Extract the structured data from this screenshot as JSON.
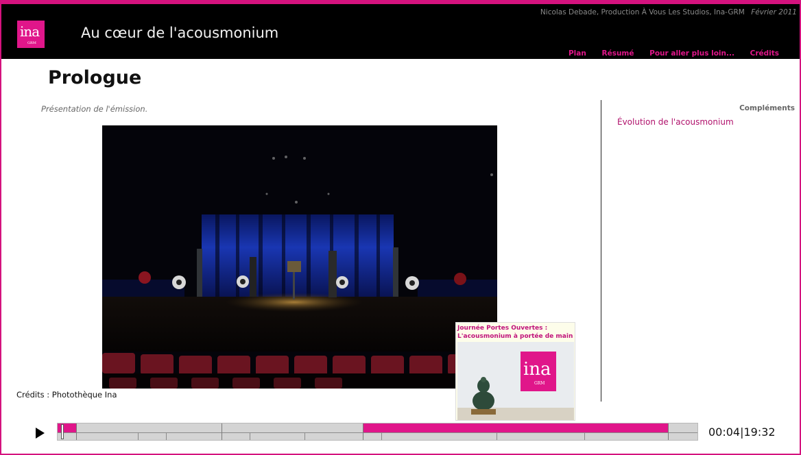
{
  "header": {
    "logo_text": "ina",
    "logo_sub": "GRM",
    "title": "Au cœur de l'acousmonium",
    "byline": "Nicolas Debade, Production À Vous Les Studios, Ina-GRM",
    "date": "Février 2011",
    "nav": [
      "Plan",
      "Résumé",
      "Pour aller plus loin...",
      "Crédits"
    ]
  },
  "main": {
    "title": "Prologue",
    "subtitle": "Présentation de l'émission.",
    "photo_credit": "Crédits : Photothèque Ina"
  },
  "side": {
    "heading": "Compléments",
    "links": [
      "Évolution de l'acousmonium"
    ]
  },
  "thumbnail": {
    "title_line1": "Journée Portes Ouvertes :",
    "title_line2": "L'acousmonium à portée de main",
    "logo_text": "ina",
    "logo_sub": "GRM"
  },
  "player": {
    "current_time": "00:04",
    "total_time": "19:32",
    "time_display": "00:04|19:32",
    "progress_fraction": 0.0034
  },
  "colors": {
    "accent": "#e0168a",
    "header_bg": "#000000"
  }
}
